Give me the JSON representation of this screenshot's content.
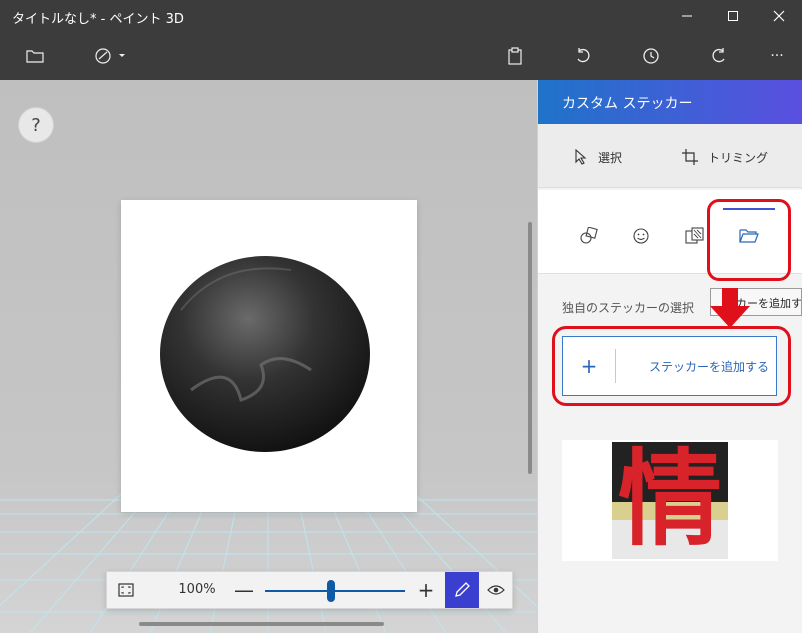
{
  "window": {
    "title": "タイトルなし* - ペイント 3D"
  },
  "toolbar": {
    "icons": [
      "folder-icon",
      "magic-select-icon",
      "paste-icon",
      "undo-icon",
      "history-icon",
      "redo-icon",
      "more-icon"
    ],
    "more_label": "···"
  },
  "canvas": {
    "help_label": "?"
  },
  "zoom": {
    "percent": "100%",
    "minus": "—",
    "plus": "+",
    "level": 0.47
  },
  "panel": {
    "title": "カスタム ステッカー",
    "modes": {
      "select_label": "選択",
      "trim_label": "トリミング"
    },
    "tabs": [
      "shape-sticker-icon",
      "emoji-sticker-icon",
      "texture-sticker-icon",
      "custom-folder-icon"
    ],
    "active_tab_index": 3,
    "tooltip": "ッカーを追加する",
    "section_label": "独自のステッカーの選択",
    "add_button": {
      "plus": "+",
      "label": "ステッカーを追加する"
    },
    "sticker_char": "情"
  },
  "colors": {
    "titlebar": "#3c3c3c",
    "accent": "#3b55d6",
    "annotation_red": "#e0101a",
    "sticker_red": "#d8232a"
  }
}
